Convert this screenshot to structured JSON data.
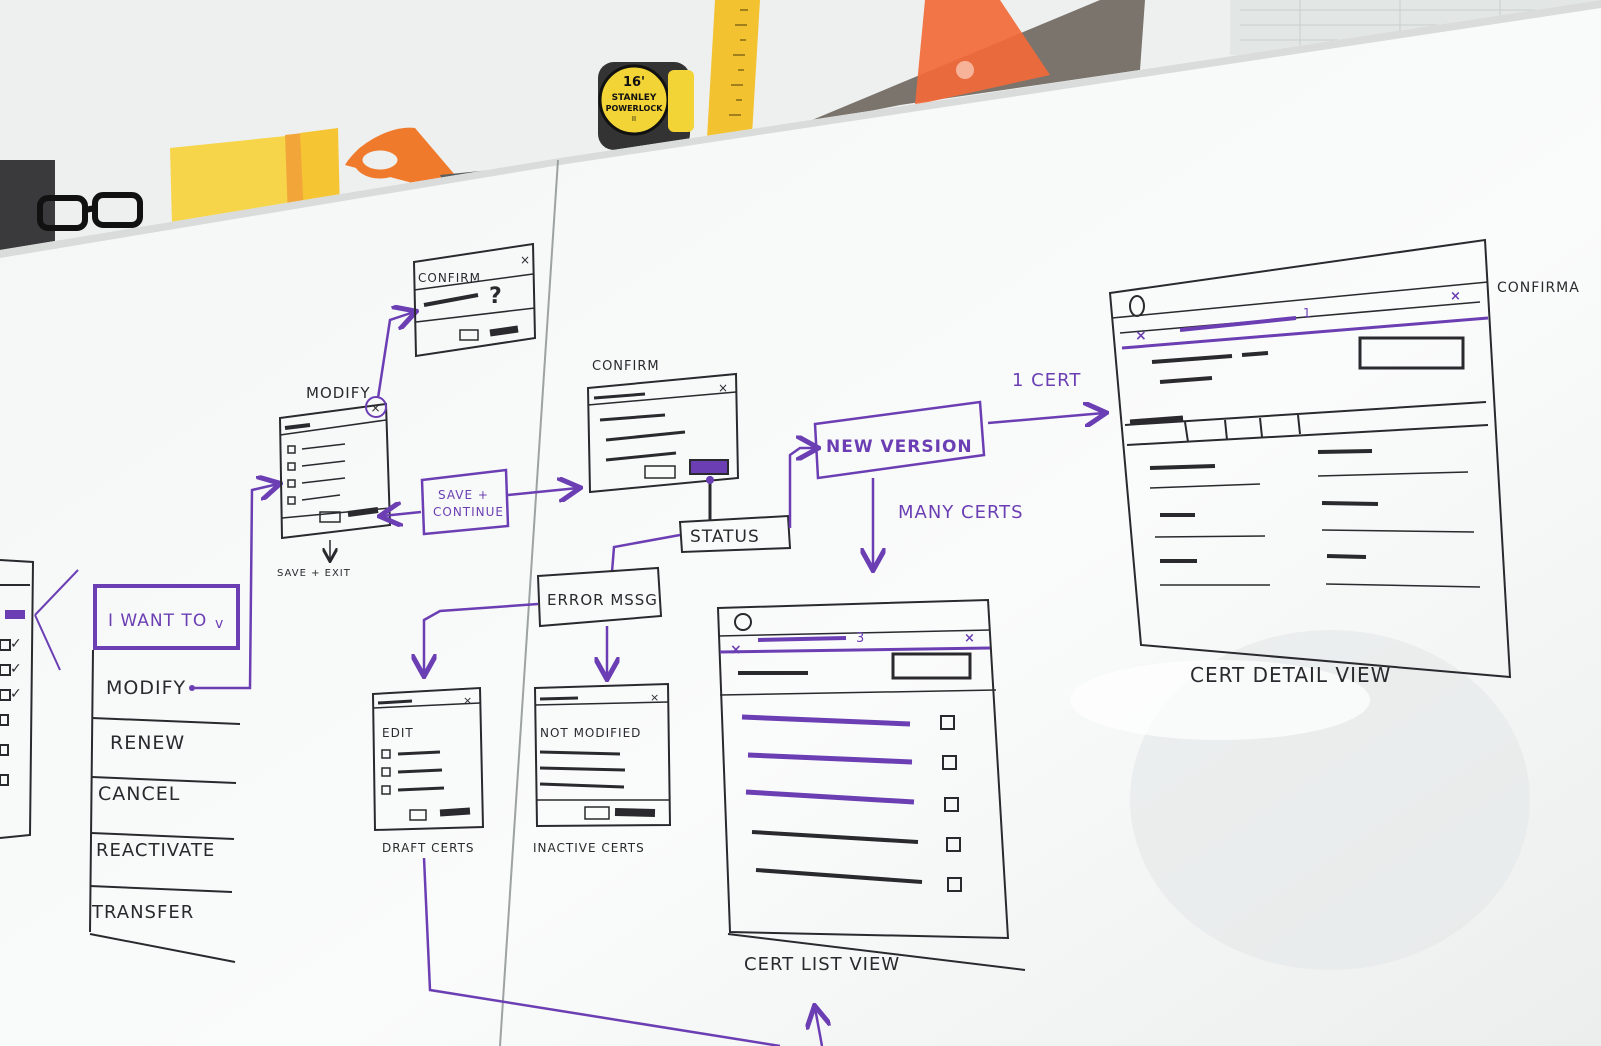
{
  "colors": {
    "wall": "#f0f1f0",
    "whiteboard": "#f7f8f8",
    "marker_black": "#2a2a2e",
    "marker_purple": "#6b3fb3",
    "sticky_yellow": "#f6d54a",
    "scissors_orange": "#f07a2b",
    "ruler_yellow": "#f2c230"
  },
  "shelf_items": {
    "tape_measure": {
      "size": "16'",
      "brand": "STANLEY",
      "model": "POWERLOCK",
      "suffix": "II"
    }
  },
  "menu": {
    "dropdown": {
      "label": "I WANT TO",
      "caret": "v"
    },
    "items": [
      "MODIFY",
      "RENEW",
      "CANCEL",
      "REACTIVATE",
      "TRANSFER"
    ]
  },
  "screens": {
    "modify": {
      "title": "MODIFY",
      "sublabel": "SAVE + EXIT"
    },
    "confirm_top": {
      "title": "CONFIRM",
      "mark": "?"
    },
    "save_continue": {
      "label_line1": "SAVE +",
      "label_line2": "CONTINUE"
    },
    "confirm_mid": {
      "title": "CONFIRM"
    },
    "status": {
      "label": "STATUS"
    },
    "new_version": {
      "label": "NEW VERSION"
    },
    "one_cert": {
      "label": "1 CERT"
    },
    "many_certs": {
      "label": "MANY CERTS"
    },
    "error_msg": {
      "label": "ERROR MSSG"
    },
    "draft": {
      "field": "EDIT",
      "caption": "DRAFT CERTS"
    },
    "inactive": {
      "field": "NOT MODIFIED",
      "caption": "INACTIVE CERTS"
    },
    "cert_list": {
      "caption": "CERT LIST VIEW",
      "badge": "3"
    },
    "cert_detail": {
      "caption": "CERT DETAIL VIEW",
      "side_label": "CONFIRMA",
      "badge": "1"
    }
  },
  "close_mark": "×",
  "check_mark": "✓"
}
